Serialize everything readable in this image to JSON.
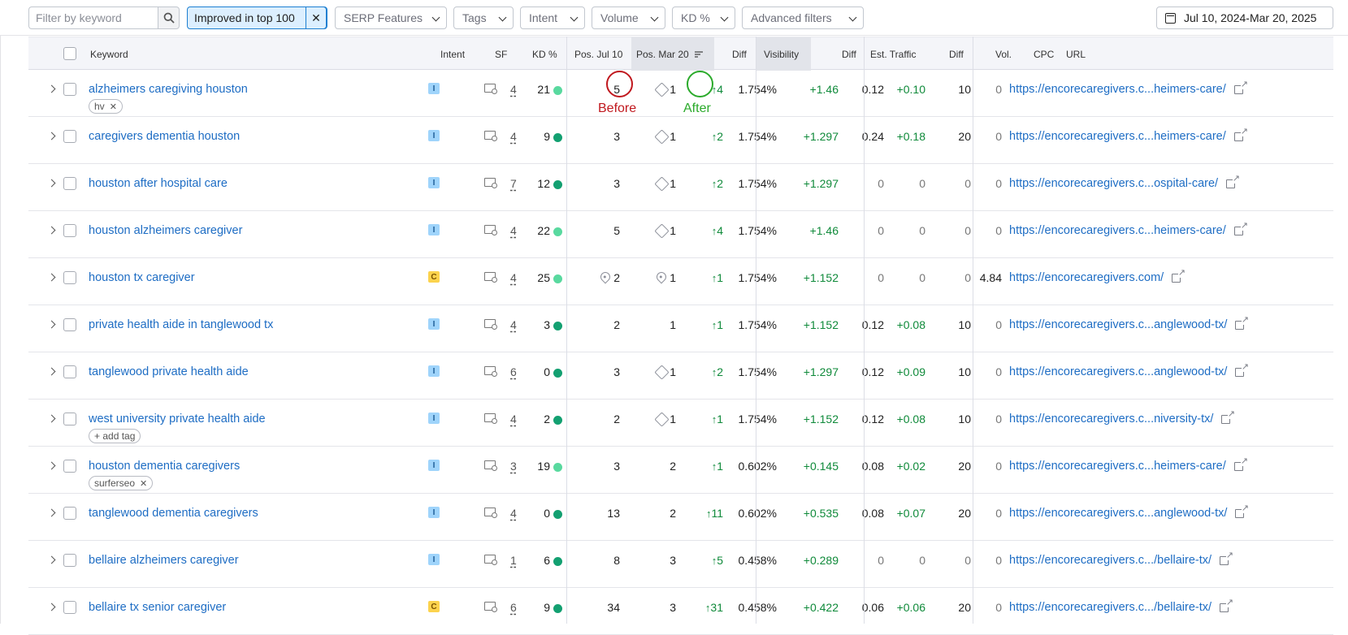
{
  "filterbar": {
    "search_placeholder": "Filter by keyword",
    "active_filter": "Improved in top 100",
    "dropdowns": [
      "SERP Features",
      "Tags",
      "Intent",
      "Volume",
      "KD %",
      "Advanced filters"
    ],
    "date_range": "Jul 10, 2024-Mar 20, 2025"
  },
  "columns": {
    "keyword": "Keyword",
    "intent": "Intent",
    "sf": "SF",
    "kd": "KD %",
    "pos_before": "Pos. Jul 10",
    "pos_after": "Pos. Mar 20",
    "diff": "Diff",
    "visibility": "Visibility",
    "vis_diff": "Diff",
    "traffic": "Est. Traffic",
    "traffic_diff": "Diff",
    "volume": "Vol.",
    "cpc": "CPC",
    "url": "URL"
  },
  "colors": {
    "kd_easy": "#59d99f",
    "kd_very_easy": "#13a071",
    "accent": "#1e6dc4",
    "positive": "#0f8a3a",
    "before_annotation": "#c0181e",
    "after_annotation": "#2aaa2a"
  },
  "annotations": {
    "before": "Before",
    "after": "After"
  },
  "rows": [
    {
      "keyword": "alzheimers caregiving houston",
      "tag": "hv",
      "intent": "I",
      "sf": "4",
      "kd": "21",
      "kd_color": "#59d99f",
      "pos_before": "5",
      "before_icon": "",
      "pos_after": "1",
      "after_icon": "featured-snippet-icon",
      "diff": "4",
      "visibility": "1.754%",
      "vis_diff": "+1.46",
      "traffic": "0.12",
      "traffic_diff": "+0.10",
      "volume": "10",
      "cpc": "0",
      "url": "https://encorecaregivers.c...heimers-care/"
    },
    {
      "keyword": "caregivers dementia houston",
      "tag": "",
      "intent": "I",
      "sf": "4",
      "kd": "9",
      "kd_color": "#13a071",
      "pos_before": "3",
      "before_icon": "",
      "pos_after": "1",
      "after_icon": "featured-snippet-icon",
      "diff": "2",
      "visibility": "1.754%",
      "vis_diff": "+1.297",
      "traffic": "0.24",
      "traffic_diff": "+0.18",
      "volume": "20",
      "cpc": "0",
      "url": "https://encorecaregivers.c...heimers-care/"
    },
    {
      "keyword": "houston after hospital care",
      "tag": "",
      "intent": "I",
      "sf": "7",
      "kd": "12",
      "kd_color": "#13a071",
      "pos_before": "3",
      "before_icon": "",
      "pos_after": "1",
      "after_icon": "featured-snippet-icon",
      "diff": "2",
      "visibility": "1.754%",
      "vis_diff": "+1.297",
      "traffic": "0",
      "traffic_diff": "0",
      "volume": "0",
      "cpc": "0",
      "url": "https://encorecaregivers.c...ospital-care/"
    },
    {
      "keyword": "houston alzheimers caregiver",
      "tag": "",
      "intent": "I",
      "sf": "4",
      "kd": "22",
      "kd_color": "#59d99f",
      "pos_before": "5",
      "before_icon": "",
      "pos_after": "1",
      "after_icon": "featured-snippet-icon",
      "diff": "4",
      "visibility": "1.754%",
      "vis_diff": "+1.46",
      "traffic": "0",
      "traffic_diff": "0",
      "volume": "0",
      "cpc": "0",
      "url": "https://encorecaregivers.c...heimers-care/"
    },
    {
      "keyword": "houston tx caregiver",
      "tag": "",
      "intent": "C",
      "sf": "4",
      "kd": "25",
      "kd_color": "#59d99f",
      "pos_before": "2",
      "before_icon": "local-pack-icon",
      "pos_after": "1",
      "after_icon": "local-pack-icon",
      "diff": "1",
      "visibility": "1.754%",
      "vis_diff": "+1.152",
      "traffic": "0",
      "traffic_diff": "0",
      "volume": "0",
      "cpc": "4.84",
      "url": "https://encorecaregivers.com/"
    },
    {
      "keyword": "private health aide in tanglewood tx",
      "tag": "",
      "intent": "I",
      "sf": "4",
      "kd": "3",
      "kd_color": "#13a071",
      "pos_before": "2",
      "before_icon": "",
      "pos_after": "1",
      "after_icon": "",
      "diff": "1",
      "visibility": "1.754%",
      "vis_diff": "+1.152",
      "traffic": "0.12",
      "traffic_diff": "+0.08",
      "volume": "10",
      "cpc": "0",
      "url": "https://encorecaregivers.c...anglewood-tx/"
    },
    {
      "keyword": "tanglewood private health aide",
      "tag": "",
      "intent": "I",
      "sf": "6",
      "kd": "0",
      "kd_color": "#13a071",
      "pos_before": "3",
      "before_icon": "",
      "pos_after": "1",
      "after_icon": "featured-snippet-icon",
      "diff": "2",
      "visibility": "1.754%",
      "vis_diff": "+1.297",
      "traffic": "0.12",
      "traffic_diff": "+0.09",
      "volume": "10",
      "cpc": "0",
      "url": "https://encorecaregivers.c...anglewood-tx/"
    },
    {
      "keyword": "west university private health aide",
      "tag": "+ add tag",
      "intent": "I",
      "sf": "4",
      "kd": "2",
      "kd_color": "#13a071",
      "pos_before": "2",
      "before_icon": "",
      "pos_after": "1",
      "after_icon": "featured-snippet-icon",
      "diff": "1",
      "visibility": "1.754%",
      "vis_diff": "+1.152",
      "traffic": "0.12",
      "traffic_diff": "+0.08",
      "volume": "10",
      "cpc": "0",
      "url": "https://encorecaregivers.c...niversity-tx/"
    },
    {
      "keyword": "houston dementia caregivers",
      "tag": "surferseo",
      "intent": "I",
      "sf": "3",
      "kd": "19",
      "kd_color": "#59d99f",
      "pos_before": "3",
      "before_icon": "",
      "pos_after": "2",
      "after_icon": "",
      "diff": "1",
      "visibility": "0.602%",
      "vis_diff": "+0.145",
      "traffic": "0.08",
      "traffic_diff": "+0.02",
      "volume": "20",
      "cpc": "0",
      "url": "https://encorecaregivers.c...heimers-care/"
    },
    {
      "keyword": "tanglewood dementia caregivers",
      "tag": "",
      "intent": "I",
      "sf": "4",
      "kd": "0",
      "kd_color": "#13a071",
      "pos_before": "13",
      "before_icon": "",
      "pos_after": "2",
      "after_icon": "",
      "diff": "11",
      "visibility": "0.602%",
      "vis_diff": "+0.535",
      "traffic": "0.08",
      "traffic_diff": "+0.07",
      "volume": "20",
      "cpc": "0",
      "url": "https://encorecaregivers.c...anglewood-tx/"
    },
    {
      "keyword": "bellaire alzheimers caregiver",
      "tag": "",
      "intent": "I",
      "sf": "1",
      "kd": "6",
      "kd_color": "#13a071",
      "pos_before": "8",
      "before_icon": "",
      "pos_after": "3",
      "after_icon": "",
      "diff": "5",
      "visibility": "0.458%",
      "vis_diff": "+0.289",
      "traffic": "0",
      "traffic_diff": "0",
      "volume": "0",
      "cpc": "0",
      "url": "https://encorecaregivers.c.../bellaire-tx/"
    },
    {
      "keyword": "bellaire tx senior caregiver",
      "tag": "",
      "intent": "C",
      "sf": "6",
      "kd": "9",
      "kd_color": "#13a071",
      "pos_before": "34",
      "before_icon": "",
      "pos_after": "3",
      "after_icon": "",
      "diff": "31",
      "visibility": "0.458%",
      "vis_diff": "+0.422",
      "traffic": "0.06",
      "traffic_diff": "+0.06",
      "volume": "20",
      "cpc": "0",
      "url": "https://encorecaregivers.c.../bellaire-tx/"
    }
  ]
}
